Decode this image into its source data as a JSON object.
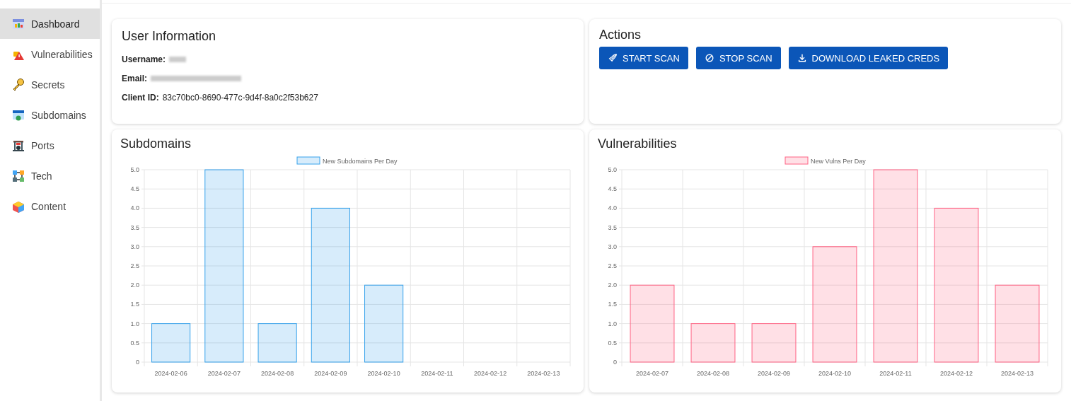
{
  "sidebar": {
    "items": [
      {
        "label": "Dashboard",
        "selected": true
      },
      {
        "label": "Vulnerabilities",
        "selected": false
      },
      {
        "label": "Secrets",
        "selected": false
      },
      {
        "label": "Subdomains",
        "selected": false
      },
      {
        "label": "Ports",
        "selected": false
      },
      {
        "label": "Tech",
        "selected": false
      },
      {
        "label": "Content",
        "selected": false
      }
    ]
  },
  "user_info": {
    "title": "User Information",
    "fields": [
      {
        "label": "Username:",
        "redacted": true
      },
      {
        "label": "Email:",
        "redacted": true
      },
      {
        "label": "Client ID:",
        "value": "83c70bc0-8690-477c-9d4f-8a0c2f53b627"
      }
    ]
  },
  "actions": {
    "title": "Actions",
    "buttons": [
      "START SCAN",
      "STOP SCAN",
      "DOWNLOAD LEAKED CREDS"
    ]
  },
  "subdomains": {
    "title": "Subdomains",
    "chart_data": {
      "type": "bar",
      "grid": true,
      "categories": [
        "2024-02-06",
        "2024-02-07",
        "2024-02-08",
        "2024-02-09",
        "2024-02-10",
        "2024-02-11",
        "2024-02-12",
        "2024-02-13"
      ],
      "series": [
        {
          "name": "New Subdomains Per Day",
          "color": "#36a2eb",
          "values": [
            1,
            5,
            1,
            4,
            2,
            0,
            0,
            0
          ]
        }
      ],
      "ylim": [
        0,
        5
      ],
      "yticks": [
        {
          "value": 0,
          "label": "0"
        },
        {
          "value": 0.5,
          "label": "0.5"
        },
        {
          "value": 1,
          "label": "1.0"
        },
        {
          "value": 1.5,
          "label": "1.5"
        },
        {
          "value": 2,
          "label": "2.0"
        },
        {
          "value": 2.5,
          "label": "2.5"
        },
        {
          "value": 3,
          "label": "3.0"
        },
        {
          "value": 3.5,
          "label": "3.5"
        },
        {
          "value": 4,
          "label": "4.0"
        },
        {
          "value": 4.5,
          "label": "4.5"
        },
        {
          "value": 5,
          "label": "5.0"
        }
      ]
    }
  },
  "vulnerabilities": {
    "title": "Vulnerabilities",
    "chart_data": {
      "type": "bar",
      "grid": true,
      "categories": [
        "2024-02-07",
        "2024-02-08",
        "2024-02-09",
        "2024-02-10",
        "2024-02-11",
        "2024-02-12",
        "2024-02-13"
      ],
      "series": [
        {
          "name": "New Vulns Per Day",
          "color": "#ff6384",
          "values": [
            2,
            1,
            1,
            3,
            5,
            4,
            2
          ]
        }
      ],
      "ylim": [
        0,
        5
      ],
      "yticks": [
        {
          "value": 0,
          "label": "0"
        },
        {
          "value": 0.5,
          "label": "0.5"
        },
        {
          "value": 1,
          "label": "1.0"
        },
        {
          "value": 1.5,
          "label": "1.5"
        },
        {
          "value": 2,
          "label": "2.0"
        },
        {
          "value": 2.5,
          "label": "2.5"
        },
        {
          "value": 3,
          "label": "3.0"
        },
        {
          "value": 3.5,
          "label": "3.5"
        },
        {
          "value": 4,
          "label": "4.0"
        },
        {
          "value": 4.5,
          "label": "4.5"
        },
        {
          "value": 5,
          "label": "5.0"
        }
      ]
    }
  }
}
